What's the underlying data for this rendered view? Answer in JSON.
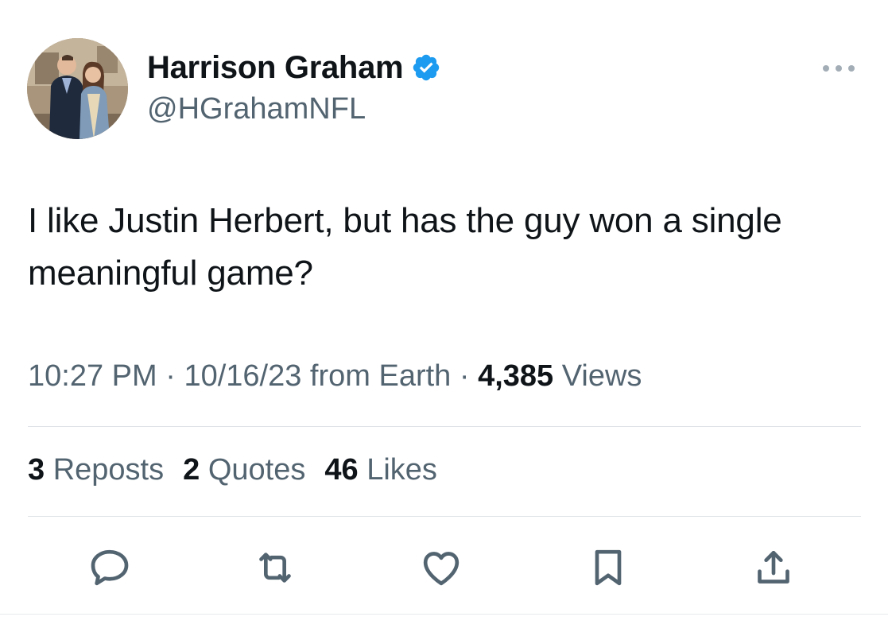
{
  "author": {
    "display_name": "Harrison Graham",
    "handle": "@HGrahamNFL",
    "verified": true,
    "verified_color": "#1d9bf0"
  },
  "tweet": {
    "text": "I like Justin Herbert, but has the guy won a single meaningful game?"
  },
  "meta": {
    "time": "10:27 PM",
    "separator": "·",
    "date_source": "10/16/23 from Earth",
    "views_count": "4,385",
    "views_label": "Views"
  },
  "stats": {
    "reposts_count": "3",
    "reposts_label": "Reposts",
    "quotes_count": "2",
    "quotes_label": "Quotes",
    "likes_count": "46",
    "likes_label": "Likes"
  },
  "actions": {
    "icons": [
      "reply-icon",
      "repost-icon",
      "like-icon",
      "bookmark-icon",
      "share-icon"
    ],
    "icon_color": "#536471"
  },
  "colors": {
    "text_primary": "#0f1419",
    "text_secondary": "#536471",
    "divider": "#dfe3e7"
  }
}
